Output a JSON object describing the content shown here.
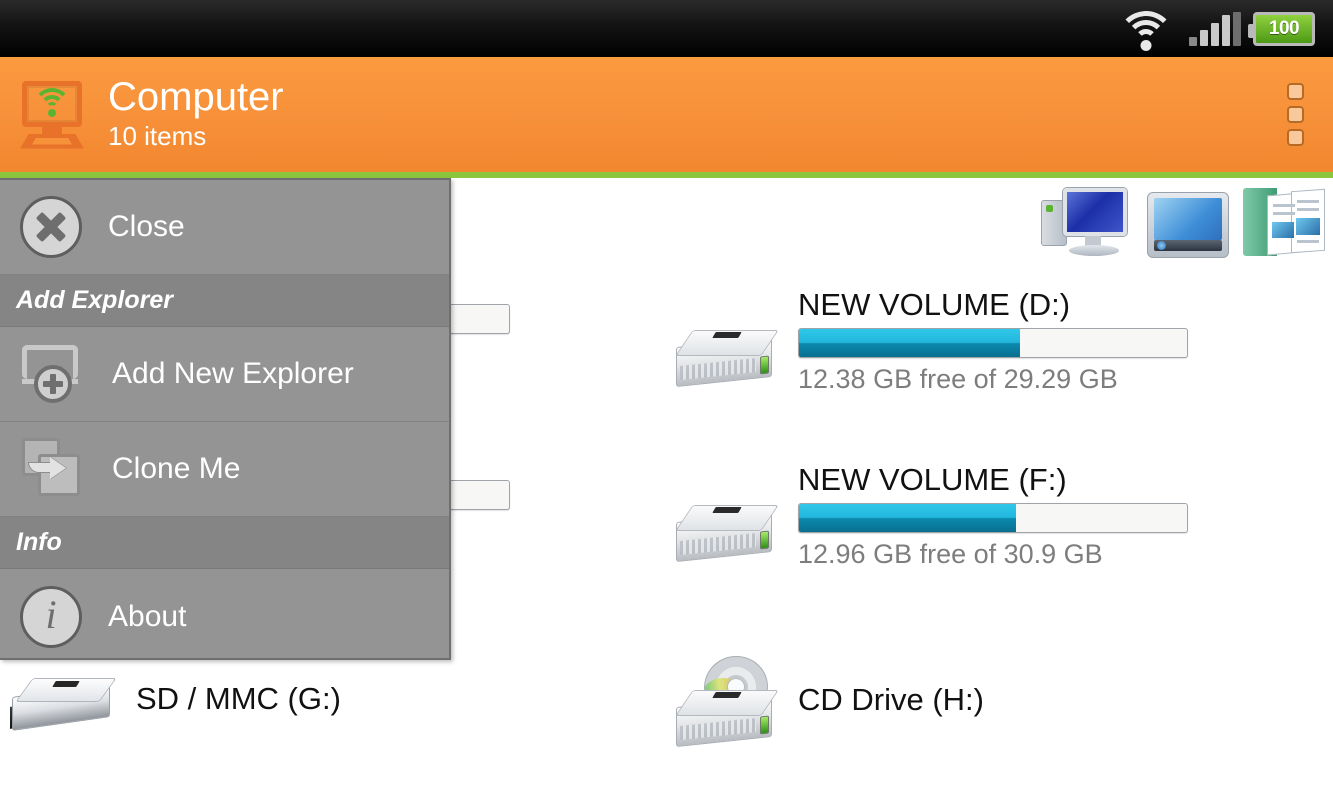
{
  "statusbar": {
    "wifi_icon": "wifi-icon",
    "signal_icon": "signal-bars-icon",
    "battery_icon": "battery-icon",
    "battery_level": "100"
  },
  "header": {
    "icon": "computer-wifi-icon",
    "title": "Computer",
    "subtitle": "10 items",
    "overflow_icon": "overflow-menu-icon",
    "bg_color": "#f7913a",
    "accent_color": "#8cc63e"
  },
  "menu": {
    "close": {
      "label": "Close",
      "icon": "close-circle-icon"
    },
    "sections": [
      {
        "title": "Add Explorer"
      },
      {
        "title": "Info"
      }
    ],
    "items": [
      {
        "label": "Add New Explorer",
        "icon": "add-new-explorer-icon"
      },
      {
        "label": "Clone Me",
        "icon": "clone-icon"
      },
      {
        "label": "About",
        "icon": "info-circle-icon"
      }
    ]
  },
  "shortcuts": [
    {
      "name": "computer-icon"
    },
    {
      "name": "desktop-icon"
    },
    {
      "name": "documents-icon"
    }
  ],
  "drives": [
    {
      "id": "drive-c-hidden",
      "title": "",
      "subtitle": "",
      "fill_percent": 84,
      "bar_color": "red",
      "icon": "hard-drive-icon"
    },
    {
      "id": "drive-d",
      "title": "NEW VOLUME (D:)",
      "subtitle": "12.38 GB free of 29.29 GB",
      "fill_percent": 57,
      "bar_color": "#23b6dc",
      "icon": "hard-drive-icon"
    },
    {
      "id": "drive-e-hidden",
      "title": "",
      "subtitle": "",
      "fill_percent": 58,
      "bar_color": "red",
      "icon": "hard-drive-icon"
    },
    {
      "id": "drive-f",
      "title": "NEW VOLUME (F:)",
      "subtitle": "12.96 GB free of 30.9 GB",
      "fill_percent": 56,
      "bar_color": "#23b6dc",
      "icon": "hard-drive-icon"
    },
    {
      "id": "drive-g",
      "title": "SD / MMC (G:)",
      "subtitle": "",
      "icon": "sd-card-icon"
    },
    {
      "id": "drive-h",
      "title": "CD Drive (H:)",
      "subtitle": "",
      "icon": "cd-drive-icon"
    }
  ]
}
